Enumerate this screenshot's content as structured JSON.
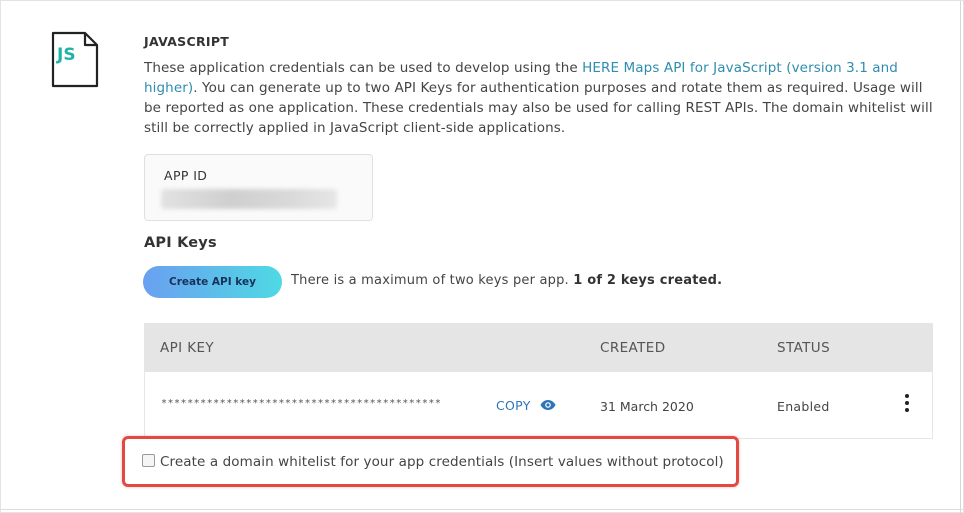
{
  "section": {
    "icon_text": "JS",
    "title": "JAVASCRIPT",
    "description_before": "These application credentials can be used to develop using the ",
    "description_link": "HERE Maps API for JavaScript (version 3.1 and higher)",
    "description_after": ". You can generate up to two API Keys for authentication purposes and rotate them as required. Usage will be reported as one application. These credentials may also be used for calling REST APIs. The domain whitelist will still be correctly applied in JavaScript client-side applications."
  },
  "app_id": {
    "label": "APP ID"
  },
  "api_keys": {
    "heading": "API Keys",
    "create_button": "Create API key",
    "max_note": "There is a maximum of two keys per app. ",
    "count_note": "1 of 2 keys created.",
    "columns": [
      "API KEY",
      "CREATED",
      "STATUS"
    ],
    "rows": [
      {
        "masked_key": "*******************************************",
        "copy_label": "COPY",
        "created": "31 March 2020",
        "status": "Enabled"
      }
    ]
  },
  "whitelist": {
    "label": "Create a domain whitelist for your app credentials (Insert values without protocol)"
  },
  "colors": {
    "accent_teal": "#1fb3a8",
    "link_blue": "#2f8dae",
    "highlight_red": "#e04a43"
  }
}
